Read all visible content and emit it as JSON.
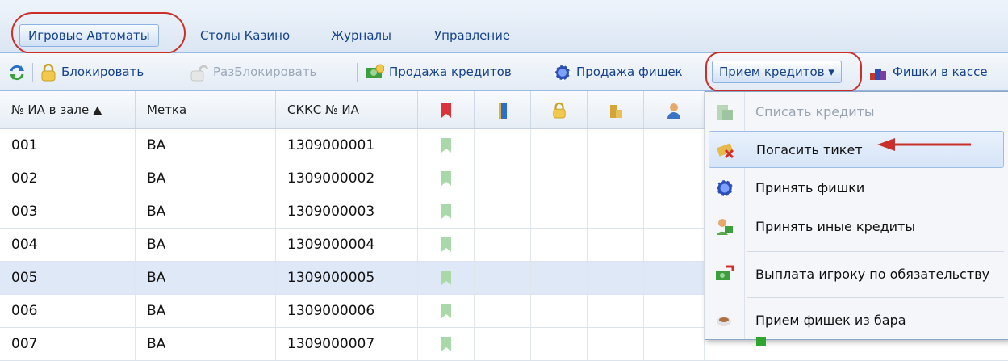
{
  "tabs": [
    {
      "label": "Игровые Автоматы",
      "active": true
    },
    {
      "label": "Столы Казино"
    },
    {
      "label": "Журналы"
    },
    {
      "label": "Управление"
    }
  ],
  "toolbar": {
    "refresh_icon": "refresh-icon",
    "lock_label": "Блокировать",
    "unlock_label": "РазБлокировать",
    "sell_credits_label": "Продажа кредитов",
    "sell_chips_label": "Продажа фишек",
    "receive_credits_label": "Прием кредитов ▾",
    "chips_in_cash_label": "Фишки в кассе"
  },
  "grid": {
    "columns": [
      "№ ИА в зале ▲",
      "Метка",
      "СККС № ИА"
    ],
    "icon_columns": [
      "bookmark-red-icon",
      "book-blue-icon",
      "lock-icon",
      "coins-icon",
      "user-icon"
    ],
    "rows": [
      {
        "num": "001",
        "tag": "BA",
        "skks": "1309000001"
      },
      {
        "num": "002",
        "tag": "BA",
        "skks": "1309000002"
      },
      {
        "num": "003",
        "tag": "BA",
        "skks": "1309000003"
      },
      {
        "num": "004",
        "tag": "BA",
        "skks": "1309000004"
      },
      {
        "num": "005",
        "tag": "BA",
        "skks": "1309000005",
        "selected": true
      },
      {
        "num": "006",
        "tag": "BA",
        "skks": "1309000006"
      },
      {
        "num": "007",
        "tag": "BA",
        "skks": "1309000007"
      }
    ]
  },
  "menu": {
    "items": [
      {
        "label": "Списать кредиты",
        "disabled": true,
        "icon": "write-off-icon"
      },
      {
        "label": "Погасить тикет",
        "hover": true,
        "icon": "ticket-icon"
      },
      {
        "label": "Принять фишки",
        "icon": "chip-icon"
      },
      {
        "label": "Принять иные кредиты",
        "icon": "money-person-icon"
      },
      {
        "label": "Выплата игроку по обязательству",
        "icon": "payout-icon"
      },
      {
        "label": "Прием фишек из бара",
        "icon": "cup-icon"
      }
    ]
  },
  "colors": {
    "accent": "#15428b",
    "annotation": "#c9302c",
    "selected_row": "#dfe8f6"
  }
}
